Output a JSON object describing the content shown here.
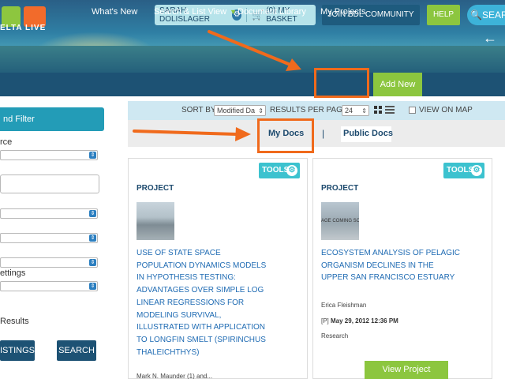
{
  "header": {
    "logo_text": "ELTA LIVE",
    "user_name": "SARAH DOLISLAGER",
    "basket": "(0) MY BASKET",
    "join": "JOIN BDL COMMUNITY",
    "help": "HELP",
    "search": "SEAR",
    "back_arrow": "←"
  },
  "nav": {
    "whats_new": "What's New",
    "search_list": "Search & List View",
    "document_library": "Document Library",
    "my_projects": "My Projects",
    "add_new": "Add New"
  },
  "sidebar": {
    "title": "nd Filter",
    "source_label": "rce",
    "settings_label": "ettings",
    "results_label": "Results",
    "listings_button": "ISTINGS",
    "search_button": "SEARCH"
  },
  "toolbar": {
    "sort_by_label": "SORT BY",
    "sort_by_value": "Modified Da",
    "results_per_page_label": "RESULTS PER PAGE",
    "results_per_page_value": "24",
    "view_on_map_label": "VIEW ON MAP"
  },
  "tabs": {
    "my_docs": "My Docs",
    "separator": "|",
    "public_docs": "Public Docs"
  },
  "cards": [
    {
      "tools": "TOOLS",
      "type": "PROJECT",
      "title": "USE OF STATE SPACE POPULATION DYNAMICS MODELS IN HYPOTHESIS TESTING: ADVANTAGES OVER SIMPLE LOG LINEAR REGRESSIONS FOR MODELING SURVIVAL, ILLUSTRATED WITH APPLICATION TO LONGFIN SMELT (SPIRINCHUS THALEICHTHYS)",
      "author": "Mark N. Maunder (1) and..."
    },
    {
      "tools": "TOOLS",
      "type": "PROJECT",
      "thumb_text": "AGE COMING SO",
      "title": "ECOSYSTEM ANALYSIS OF PELAGIC ORGANISM DECLINES IN THE UPPER SAN FRANCISCO ESTUARY",
      "author": "Erica Fleishman",
      "date_prefix": "[P]",
      "date": "May 29, 2012 12:36 PM",
      "category": "Research",
      "view_button": "View Project"
    }
  ],
  "colors": {
    "nav_bg": "#1d5274",
    "accent_green": "#8cc63f",
    "annotation_orange": "#f06a1c",
    "link_blue": "#1f6bb3"
  }
}
